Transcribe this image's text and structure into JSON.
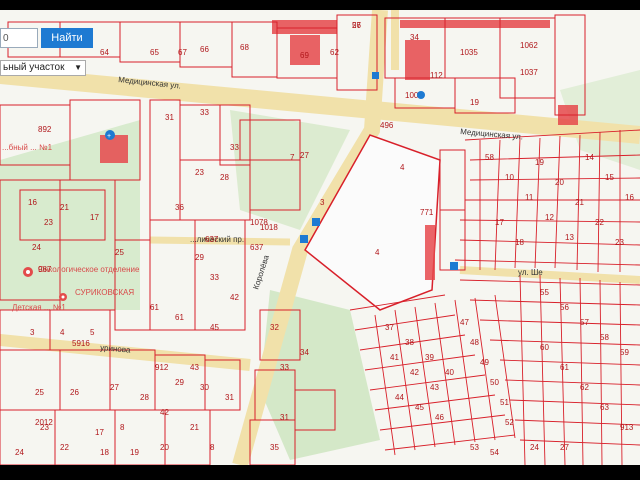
{
  "search": {
    "value": "0",
    "button_label": "Найти"
  },
  "parcel_type": {
    "selected": "ьный участок"
  },
  "streets": [
    "Медицинская ул.",
    "Медицинская ул.",
    "уринова",
    "ул. Ше",
    "...лический пр.",
    "Королёва"
  ],
  "places": [
    "Онкологическое отделение",
    "СУРИКОВСКАЯ",
    "Детская ... №1",
    "...бный ... №1"
  ],
  "parcel_numbers": [
    "57",
    "62",
    "64",
    "65",
    "66",
    "67",
    "68",
    "69",
    "34",
    "1035",
    "1062",
    "112",
    "1037",
    "19",
    "100",
    "496",
    "892",
    "31",
    "33",
    "33",
    "28",
    "23",
    "27",
    "7",
    "3",
    "4",
    "4",
    "771",
    "16",
    "21",
    "23",
    "24",
    "17",
    "25",
    "36",
    "29",
    "33",
    "42",
    "45",
    "61",
    "1018",
    "637",
    "637",
    "61",
    "3",
    "4",
    "5",
    "987",
    "5916",
    "8",
    "17",
    "18",
    "19",
    "20",
    "21",
    "22",
    "23",
    "24",
    "25",
    "26",
    "27",
    "28",
    "29",
    "30",
    "31",
    "32",
    "33",
    "34",
    "35",
    "37",
    "38",
    "39",
    "40",
    "41",
    "42",
    "43",
    "44",
    "45",
    "46",
    "47",
    "48",
    "49",
    "50",
    "51",
    "52",
    "53",
    "54",
    "55",
    "56",
    "57",
    "58",
    "59",
    "60",
    "61",
    "62",
    "63",
    "913",
    "912",
    "43",
    "42",
    "1078",
    "2012",
    "8",
    "31",
    "58",
    "10",
    "11",
    "12",
    "13",
    "14",
    "15",
    "16",
    "17",
    "18",
    "19",
    "20",
    "21",
    "22",
    "23",
    "24",
    "27",
    "26"
  ],
  "colors": {
    "parcel": "#d8202a",
    "road": "#f1e1aa",
    "green": "#d4e8c8",
    "bg": "#f6f6f1",
    "button": "#1e7ad2"
  },
  "icons": [
    "search-icon",
    "pin-icon",
    "bus-stop-icon",
    "hospital-icon"
  ]
}
